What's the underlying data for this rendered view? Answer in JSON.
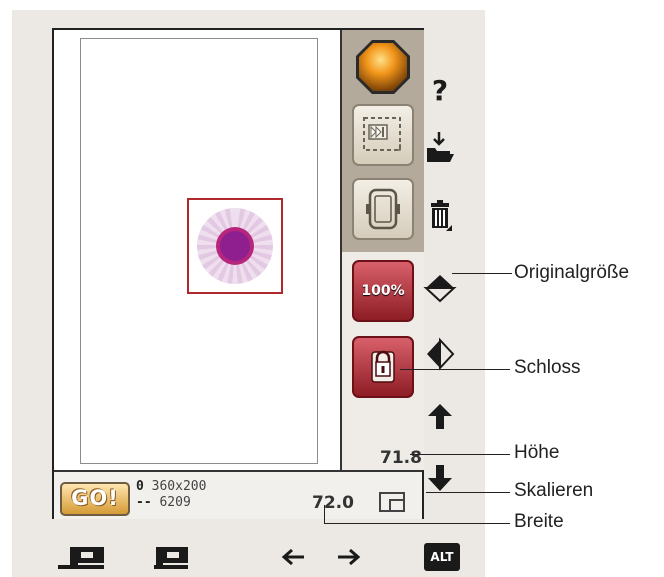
{
  "toolbar": {
    "zoom_button_label": "100%"
  },
  "status": {
    "go_label": "GO!",
    "hoop_size": "360x200",
    "stitch_count": "6209",
    "hoop_symbol": "0",
    "stitch_symbol": "--"
  },
  "values": {
    "height": "71.8",
    "width": "72.0"
  },
  "side": {
    "help_label": "?"
  },
  "callouts": {
    "original_size": "Originalgröße",
    "lock": "Schloss",
    "height": "Höhe",
    "scale": "Skalieren",
    "width": "Breite"
  },
  "bottom": {
    "alt_label": "ALT"
  },
  "colors": {
    "accent_red": "#8e1d26",
    "go_orange": "#d59a35",
    "panel_tan": "#b3aa9c"
  },
  "icons": [
    "gem-icon",
    "skip-icon",
    "hoop-icon",
    "help-icon",
    "load-icon",
    "trash-icon",
    "flip-vertical-icon",
    "flip-horizontal-icon",
    "arrow-up-icon",
    "arrow-down-icon",
    "scale-icon",
    "sewing-mode-icon",
    "embroidery-mode-icon",
    "arrow-left-icon",
    "arrow-right-icon",
    "alt-icon"
  ]
}
